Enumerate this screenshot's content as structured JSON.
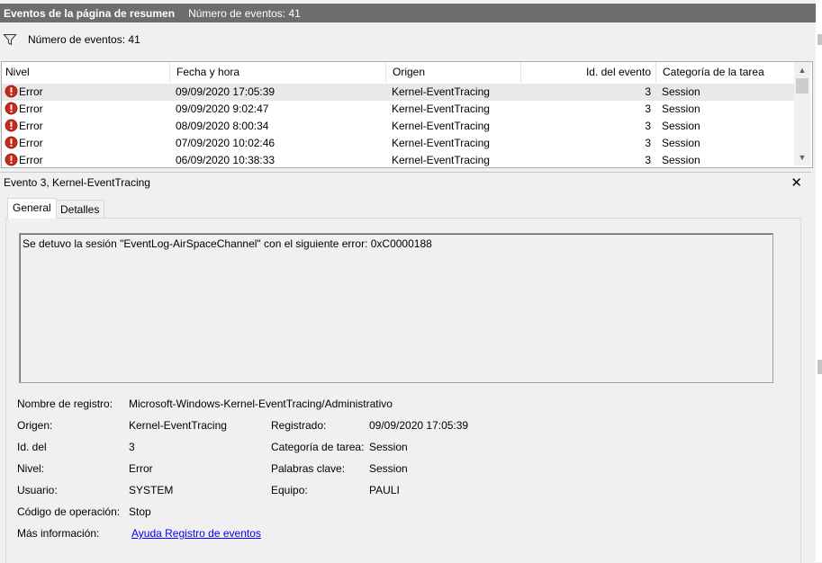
{
  "title_bar": {
    "title": "Eventos de la página de resumen",
    "count": "Número de eventos: 41"
  },
  "filter": {
    "icon": "filter-icon",
    "label": "Número de eventos: 41"
  },
  "table": {
    "headers": [
      "Nivel",
      "Fecha y hora",
      "Origen",
      "Id. del evento",
      "Categoría de la tarea"
    ],
    "rows": [
      {
        "level": "Error",
        "datetime": "09/09/2020 17:05:39",
        "source": "Kernel-EventTracing",
        "id": "3",
        "category": "Session"
      },
      {
        "level": "Error",
        "datetime": "09/09/2020 9:02:47",
        "source": "Kernel-EventTracing",
        "id": "3",
        "category": "Session"
      },
      {
        "level": "Error",
        "datetime": "08/09/2020 8:00:34",
        "source": "Kernel-EventTracing",
        "id": "3",
        "category": "Session"
      },
      {
        "level": "Error",
        "datetime": "07/09/2020 10:02:46",
        "source": "Kernel-EventTracing",
        "id": "3",
        "category": "Session"
      },
      {
        "level": "Error",
        "datetime": "06/09/2020 10:38:33",
        "source": "Kernel-EventTracing",
        "id": "3",
        "category": "Session"
      }
    ],
    "selected_index": 0
  },
  "detail": {
    "title": "Evento 3, Kernel-EventTracing",
    "tabs": [
      "General",
      "Detalles"
    ],
    "active_tab": "General",
    "message": "Se detuvo la sesión \"EventLog-AirSpaceChannel\" con el siguiente error: 0xC0000188",
    "fields": {
      "log_name_label": "Nombre de registro:",
      "log_name": "Microsoft-Windows-Kernel-EventTracing/Administrativo",
      "source_label": "Origen:",
      "source": "Kernel-EventTracing",
      "logged_label": "Registrado:",
      "logged": "09/09/2020 17:05:39",
      "id_label": "Id. del",
      "id": "3",
      "task_category_label": "Categoría de tarea:",
      "task_category": "Session",
      "level_label": "Nivel:",
      "level": "Error",
      "keywords_label": "Palabras clave:",
      "keywords": "Session",
      "user_label": "Usuario:",
      "user": "SYSTEM",
      "computer_label": "Equipo:",
      "computer": "PAULI",
      "opcode_label": "Código de operación:",
      "opcode": "Stop",
      "more_info_label": "Más información:",
      "more_info_link": "Ayuda Registro de eventos"
    }
  },
  "colors": {
    "title_bar_bg": "#6d6d6d",
    "error_icon": "#c42b1c",
    "link": "#0000ff",
    "selected_row": "#e9e9e9"
  }
}
